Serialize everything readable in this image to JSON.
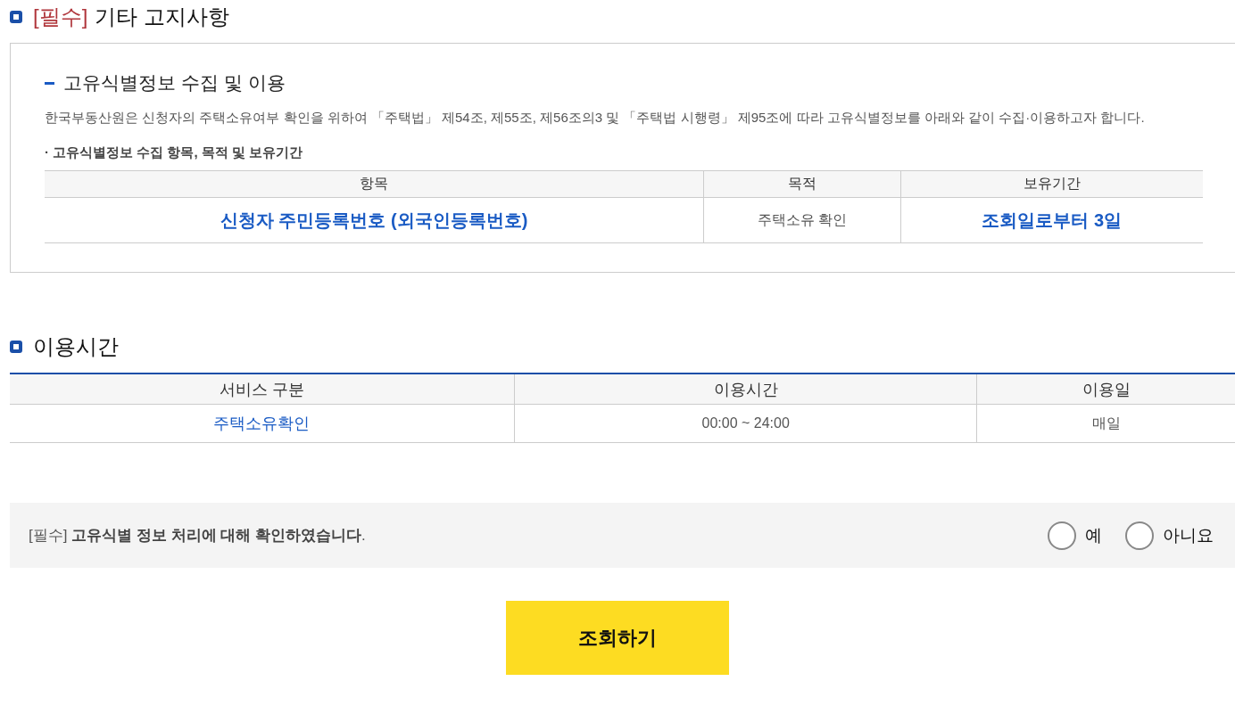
{
  "notice_section": {
    "tag": "[필수]",
    "title": "기타 고지사항",
    "subsection_title": "고유식별정보 수집 및 이용",
    "description": "한국부동산원은 신청자의 주택소유여부 확인을 위하여 「주택법」 제54조, 제55조, 제56조의3 및 「주택법 시행령」 제95조에 따라 고유식별정보를 아래와 같이 수집·이용하고자 합니다.",
    "list_caption": "· 고유식별정보 수집 항목, 목적 및 보유기간",
    "table": {
      "columns": [
        "항목",
        "목적",
        "보유기간"
      ],
      "rows": [
        [
          {
            "text": "신청자 주민등록번호 (외국인등록번호)",
            "kind": "emphasis"
          },
          {
            "text": "주택소유 확인",
            "kind": "plain"
          },
          {
            "text": "조회일로부터 3일",
            "kind": "emphasis"
          }
        ]
      ]
    }
  },
  "hours_section": {
    "title": "이용시간",
    "table": {
      "columns": [
        "서비스 구분",
        "이용시간",
        "이용일"
      ],
      "rows": [
        [
          {
            "text": "주택소유확인",
            "kind": "link"
          },
          {
            "text": "00:00 ~ 24:00",
            "kind": "plain"
          },
          {
            "text": "매일",
            "kind": "plain"
          }
        ]
      ]
    }
  },
  "consent": {
    "text": "[필수] **고유식별 정보 처리에 대해 확인하였습니다**.",
    "options": [
      {
        "label": "예",
        "selected": false
      },
      {
        "label": "아니요",
        "selected": false
      }
    ]
  },
  "submit_button": "조회하기"
}
